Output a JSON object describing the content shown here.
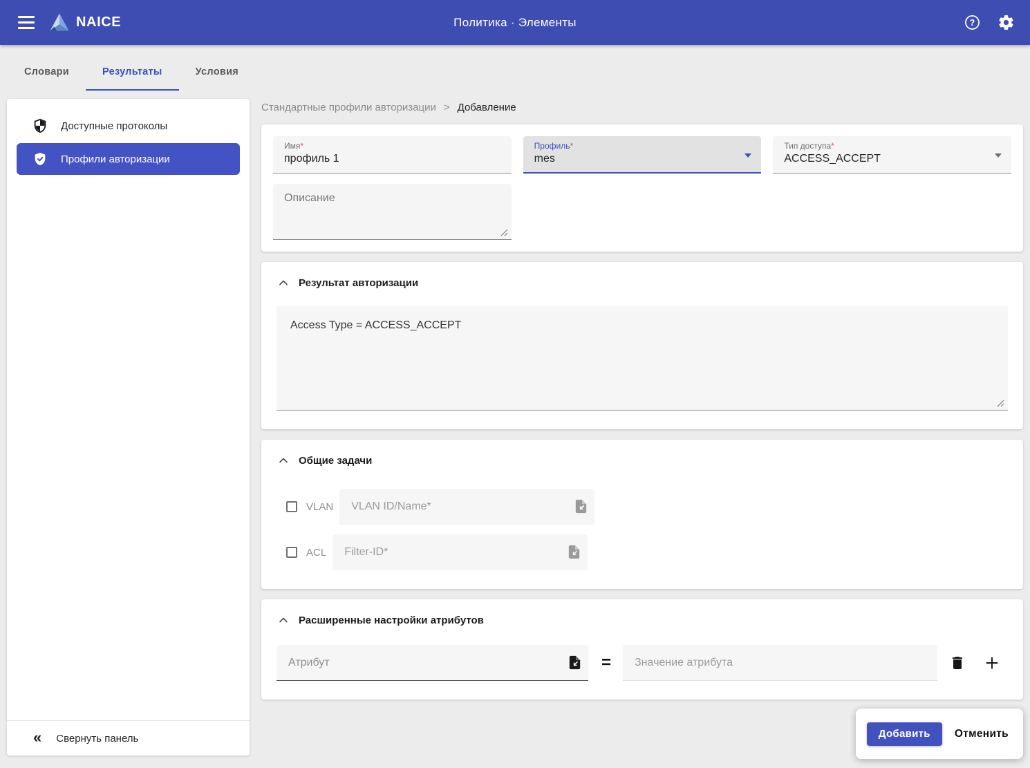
{
  "app_bar": {
    "brand": "NAICE",
    "title": "Политика · Элементы"
  },
  "tabs": [
    {
      "label": "Словари",
      "active": false
    },
    {
      "label": "Результаты",
      "active": true
    },
    {
      "label": "Условия",
      "active": false
    }
  ],
  "sidebar": {
    "items": [
      {
        "label": "Доступные протоколы",
        "icon": "shield-icon",
        "selected": false
      },
      {
        "label": "Профили авторизации",
        "icon": "shield-check-icon",
        "selected": true
      }
    ],
    "collapse_label": "Свернуть панель",
    "collapse_icon": "double-chevron-left-icon"
  },
  "breadcrumb": {
    "parent": "Стандартные профили авторизации",
    "separator": ">",
    "current": "Добавление"
  },
  "form": {
    "name": {
      "label": "Имя",
      "required": "*",
      "value": "профиль 1"
    },
    "profile": {
      "label": "Профиль",
      "required": "*",
      "value": "mes",
      "focused": true
    },
    "access_type": {
      "label": "Тип доступа",
      "required": "*",
      "value": "ACCESS_ACCEPT"
    },
    "description": {
      "label": "Описание",
      "value": ""
    }
  },
  "auth_result": {
    "title": "Результат авторизации",
    "value": "Access Type = ACCESS_ACCEPT"
  },
  "common_tasks": {
    "title": "Общие задачи",
    "rows": [
      {
        "checkbox_label": "VLAN",
        "checked": false,
        "placeholder": "VLAN ID/Name*",
        "icon": "file-import-icon"
      },
      {
        "checkbox_label": "ACL",
        "checked": false,
        "placeholder": "Filter-ID*",
        "icon": "file-import-icon"
      }
    ]
  },
  "advanced": {
    "title": "Расширенные настройки атрибутов",
    "attribute_placeholder": "Атрибут",
    "equals": "=",
    "value_placeholder": "Значение атрибута"
  },
  "actions": {
    "submit": "Добавить",
    "cancel": "Отменить"
  },
  "colors": {
    "appbar": "#3E4DB1",
    "accent": "#3A4FC0",
    "selected_item": "#4353C4",
    "primary_button": "#4152BE",
    "required_asterisk": "#E0474C"
  }
}
